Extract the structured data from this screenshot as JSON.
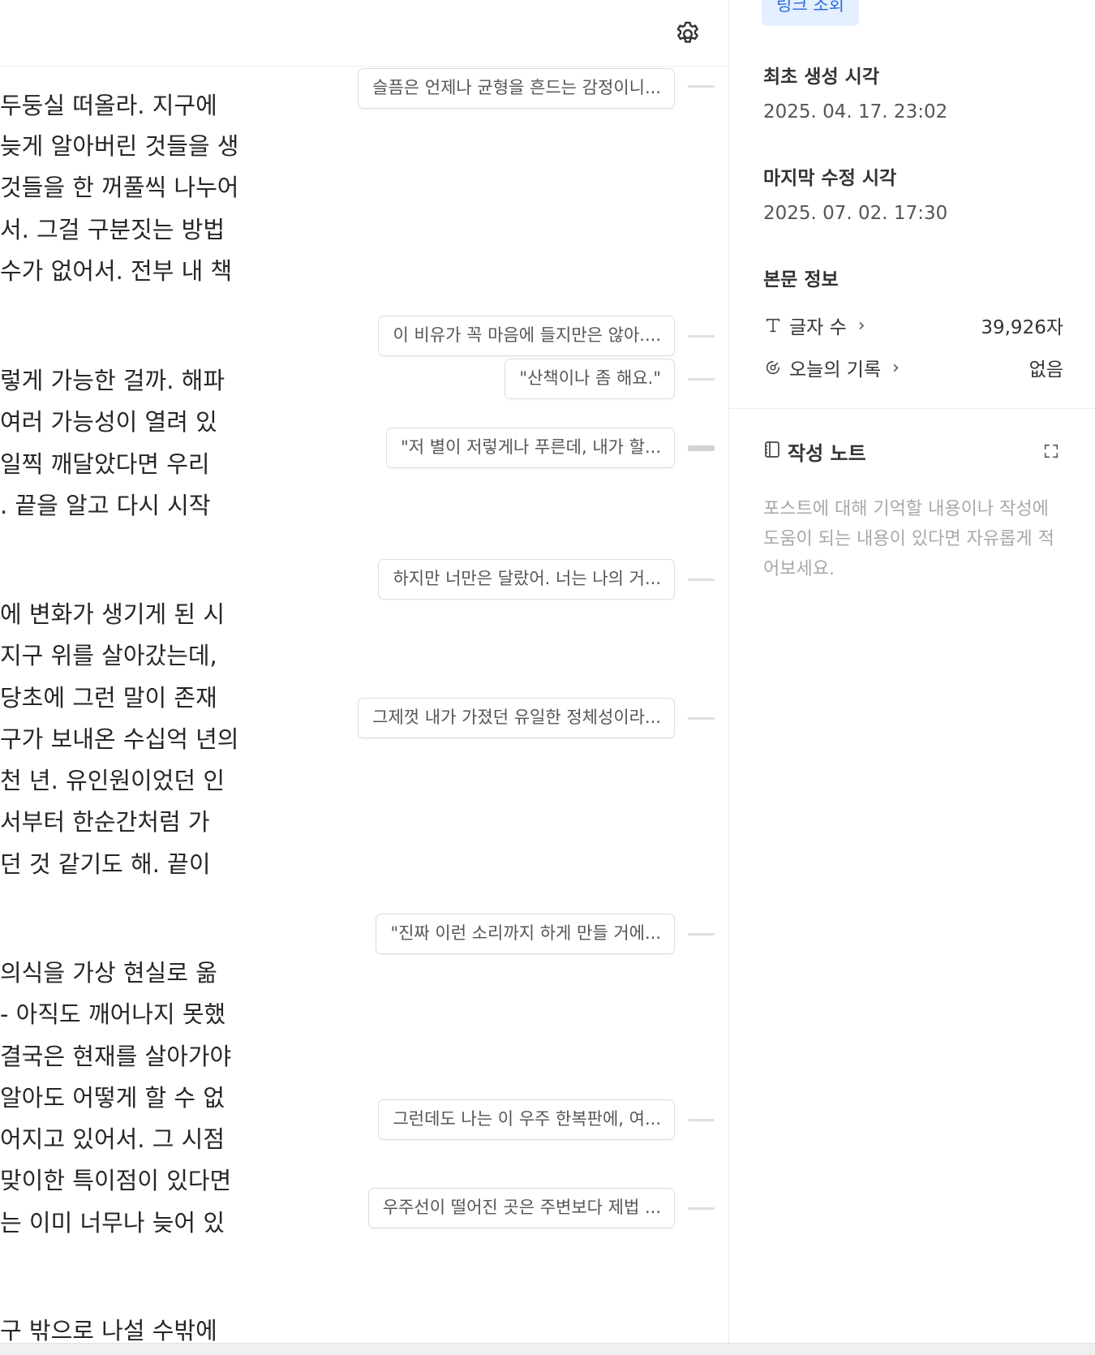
{
  "editor": {
    "body_lines": [
      " 두둥실 떠올라. 지구에",
      "늦게 알아버린 것들을 생",
      "것들을 한 꺼풀씩 나누어",
      "서. 그걸 구분짓는 방법",
      "수가 없어서. 전부 내 책",
      "렇게 가능한 걸까. 해파",
      "여러 가능성이 열려 있",
      " 일찍 깨달았다면 우리",
      ". 끝을 알고 다시 시작",
      "에 변화가 생기게 된 시",
      "지구 위를 살아갔는데,",
      " 당초에 그런 말이 존재",
      "구가 보내온 수십억 년의",
      "천 년. 유인원이었던 인",
      "서부터 한순간처럼 가",
      "던 것 같기도 해. 끝이",
      "의식을 가상 현실로 옮",
      "- 아직도 깨어나지 못했",
      "결국은 현재를 살아가야",
      " 알아도 어떻게 할 수 없",
      "어지고 있어서. 그 시점",
      "맞이한 특이점이 있다면",
      "는 이미 너무나 늦어 있",
      "구 밖으로 나설 수밖에"
    ],
    "memos": [
      "슬픔은 언제나 균형을 흔드는 감정이니...",
      "이 비유가 꼭 마음에 들지만은 않아....",
      "\"산책이나 좀 해요.\"",
      "\"저 별이 저렇게나 푸른데, 내가 할...",
      "하지만 너만은 달랐어. 너는 나의 거...",
      "그제껏 내가 가졌던 유일한 정체성이라...",
      "\"진짜 이런 소리까지 하게 만들 거에...",
      "그런데도 나는 이 우주 한복판에, 여...",
      "우주선이 떨어진 곳은 주변보다 제법 ..."
    ],
    "settings_icon": "gear-icon"
  },
  "panel": {
    "link_badge": "링크 조회",
    "created_label": "최초 생성 시각",
    "created_value": "2025. 04. 17. 23:02",
    "modified_label": "마지막 수정 시각",
    "modified_value": "2025. 07. 02. 17:30",
    "body_info_label": "본문 정보",
    "char_count_label": "글자 수",
    "char_count_value": "39,926자",
    "char_count_icon": "text-t-icon",
    "today_label": "오늘의 기록",
    "today_value": "없음",
    "today_icon": "gauge-icon",
    "note_title": "작성 노트",
    "note_icon": "notebook-icon",
    "expand_icon": "expand-icon",
    "note_placeholder": "포스트에 대해 기억할 내용이나 작성에 도움이 되는 내용이 있다면 자유롭게 적어보세요."
  },
  "colors": {
    "accent": "#2f6de1",
    "accent_bg": "#e4efff",
    "divider": "#ececec"
  }
}
